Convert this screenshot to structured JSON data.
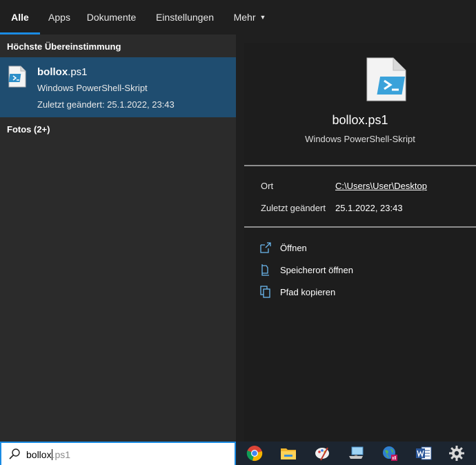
{
  "tabs": [
    {
      "label": "Alle",
      "active": true
    },
    {
      "label": "Apps"
    },
    {
      "label": "Dokumente"
    },
    {
      "label": "Einstellungen"
    },
    {
      "label": "Mehr",
      "has_dropdown": true
    }
  ],
  "results": {
    "best_match_header": "Höchste Übereinstimmung",
    "best_match": {
      "name_bold": "bollox",
      "name_rest": ".ps1",
      "type": "Windows PowerShell-Skript",
      "modified": "Zuletzt geändert: 25.1.2022, 23:43",
      "icon": "powershell-file-icon"
    },
    "photos_header": "Fotos (2+)"
  },
  "details": {
    "name": "bollox.ps1",
    "type": "Windows PowerShell-Skript",
    "location_label": "Ort",
    "location_value": "C:\\Users\\User\\Desktop",
    "modified_label": "Zuletzt geändert",
    "modified_value": "25.1.2022, 23:43",
    "actions": [
      {
        "label": "Öffnen",
        "icon": "open-icon"
      },
      {
        "label": "Speicherort öffnen",
        "icon": "file-location-icon"
      },
      {
        "label": "Pfad kopieren",
        "icon": "copy-path-icon"
      }
    ]
  },
  "search": {
    "typed": "bollox",
    "suggestion": ".ps1",
    "icon": "search-icon"
  },
  "taskbar": {
    "icons": [
      "chrome-icon",
      "file-explorer-icon",
      "paint-icon",
      "network-computer-icon",
      "globe-app-icon",
      "word-icon",
      "settings-icon"
    ]
  },
  "colors": {
    "accent": "#1a8be3",
    "selection": "#1f4d70",
    "pane_left": "#2b2b2b",
    "pane_right": "#1d1d1d"
  }
}
